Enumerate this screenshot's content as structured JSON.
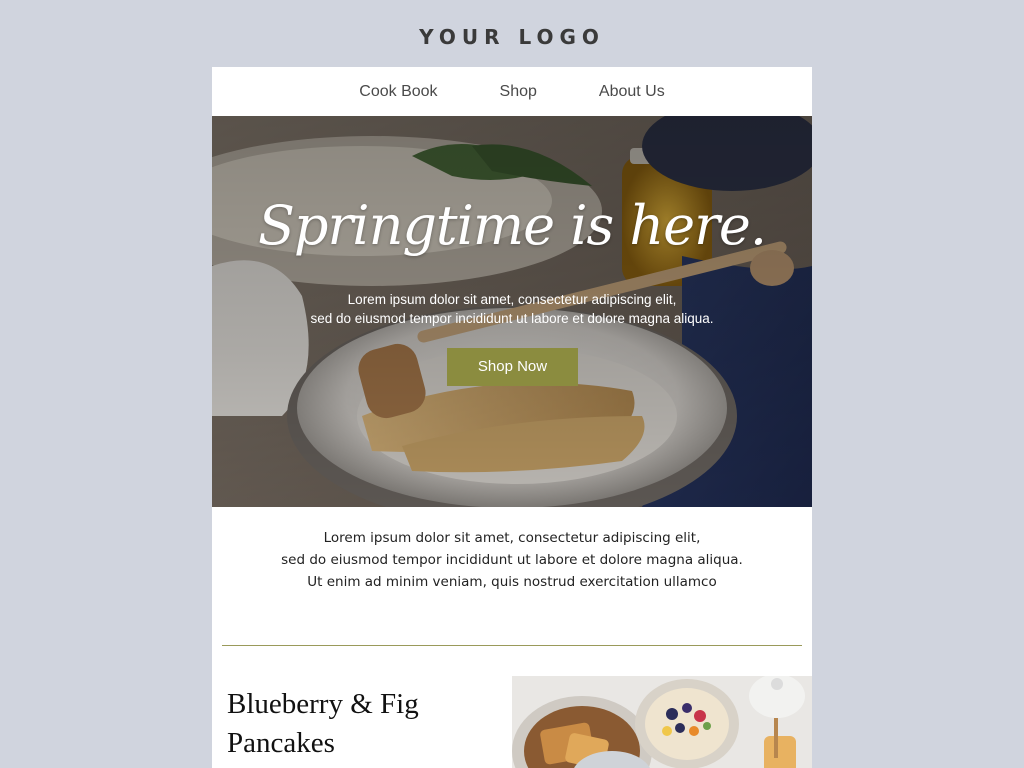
{
  "logo": {
    "text": "YOUR LOGO"
  },
  "nav": {
    "items": [
      {
        "label": "Cook Book"
      },
      {
        "label": "Shop"
      },
      {
        "label": "About Us"
      }
    ]
  },
  "hero": {
    "title": "Springtime is here.",
    "subtitle_line1": "Lorem ipsum dolor sit amet, consectetur adipiscing elit,",
    "subtitle_line2": "sed do eiusmod tempor incididunt ut labore et dolore magna aliqua.",
    "button_label": "Shop Now",
    "button_color": "#8b8c3f"
  },
  "intro": {
    "line1": "Lorem ipsum dolor sit amet, consectetur adipiscing elit,",
    "line2": "sed do eiusmod tempor incididunt ut labore et dolore magna aliqua.",
    "line3": "Ut enim ad minim veniam, quis nostrud exercitation ullamco"
  },
  "recipe": {
    "title_line1": "Blueberry & Fig",
    "title_line2": "Pancakes"
  },
  "colors": {
    "page_background": "#d0d4de",
    "accent": "#8b8c3f",
    "divider": "#9a9a5a"
  }
}
